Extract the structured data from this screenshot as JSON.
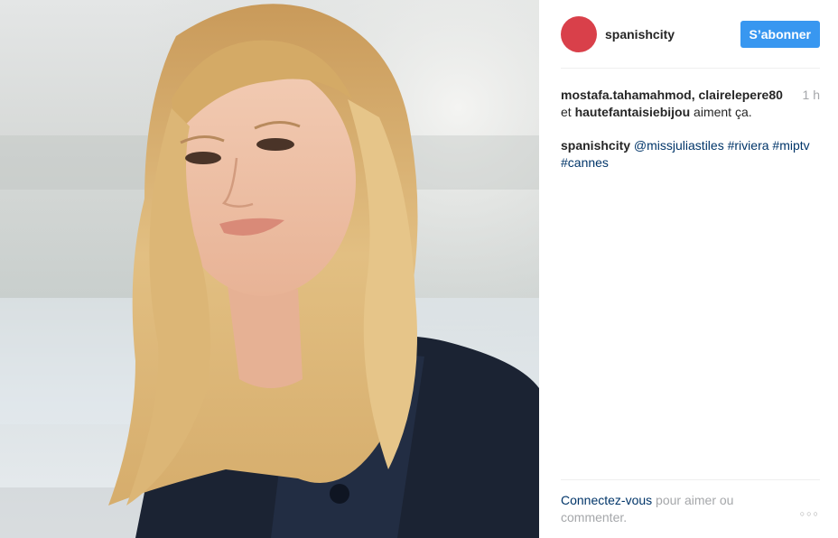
{
  "header": {
    "username": "spanishcity",
    "follow_label": "S’abonner"
  },
  "likes": {
    "user1": "mostafa.tahamahmod",
    "sep1": ", ",
    "user2": "clairelepere80",
    "and": "et ",
    "user3": "hautefantaisiebijou",
    "suffix": " aiment ça.",
    "time": "1 h"
  },
  "caption": {
    "author": "spanishcity",
    "mention": "@missjuliastiles",
    "tags": [
      "#riviera",
      "#miptv",
      "#cannes"
    ]
  },
  "footer": {
    "login_link": "Connectez-vous",
    "rest": " pour aimer ou commenter.",
    "more_glyph": "○○○"
  },
  "colors": {
    "follow_button": "#3897f0",
    "avatar": "#d9404a",
    "link": "#003569",
    "muted": "#a5a7aa"
  },
  "photo": {
    "subject": "smiling woman with long wavy blonde hair wearing dark navy lace jacket, blurred seaside background"
  }
}
